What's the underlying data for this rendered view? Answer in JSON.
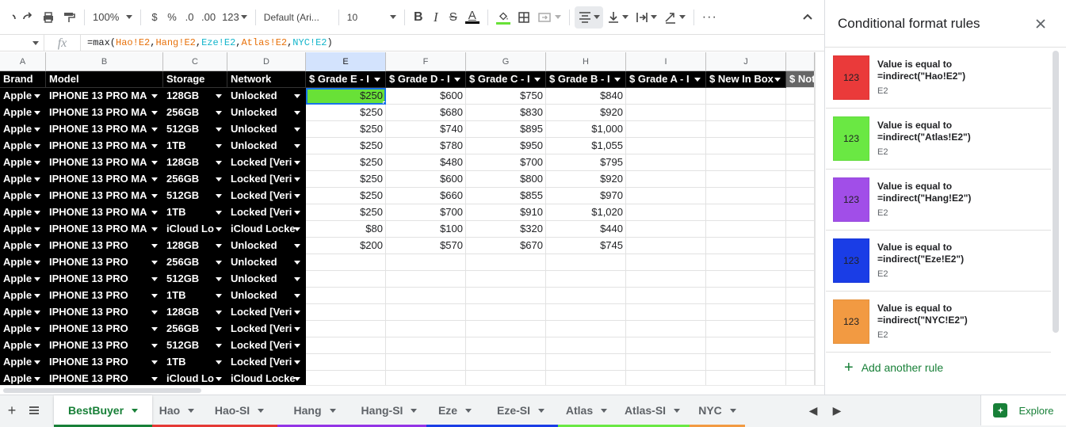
{
  "toolbar": {
    "zoom": "100%",
    "currency": "$",
    "percent": "%",
    "dec_decrease": ".0",
    "dec_increase": ".00",
    "more_formats": "123",
    "font": "Default (Ari...",
    "font_size": "10",
    "bold": "B",
    "italic": "I",
    "strike": "S",
    "text_color": "A",
    "more": "···"
  },
  "formula_bar": {
    "fx": "fx",
    "formula_prefix": "=max(",
    "refs": [
      "Hao!E2",
      "Hang!E2",
      "Eze!E2",
      "Atlas!E2",
      "NYC!E2"
    ],
    "comma": ",",
    "formula_suffix": ")"
  },
  "grid": {
    "columns": [
      "A",
      "B",
      "C",
      "D",
      "E",
      "F",
      "G",
      "H",
      "I",
      "J"
    ],
    "selected_column": "E",
    "headers": [
      "Brand",
      "Model",
      "Storage",
      "Network",
      "$ Grade E - I",
      "$ Grade D - I",
      "$ Grade C - I",
      "$ Grade B - I",
      "$ Grade A - I",
      "$ New In Box",
      "$ Not"
    ],
    "rows": [
      [
        "Apple",
        "IPHONE 13 PRO MA",
        "128GB",
        "Unlocked",
        "$250",
        "$600",
        "$750",
        "$840"
      ],
      [
        "Apple",
        "IPHONE 13 PRO MA",
        "256GB",
        "Unlocked",
        "$250",
        "$680",
        "$830",
        "$920"
      ],
      [
        "Apple",
        "IPHONE 13 PRO MA",
        "512GB",
        "Unlocked",
        "$250",
        "$740",
        "$895",
        "$1,000"
      ],
      [
        "Apple",
        "IPHONE 13 PRO MA",
        "1TB",
        "Unlocked",
        "$250",
        "$780",
        "$950",
        "$1,055"
      ],
      [
        "Apple",
        "IPHONE 13 PRO MA",
        "128GB",
        "Locked [Veri",
        "$250",
        "$480",
        "$700",
        "$795"
      ],
      [
        "Apple",
        "IPHONE 13 PRO MA",
        "256GB",
        "Locked [Veri",
        "$250",
        "$600",
        "$800",
        "$920"
      ],
      [
        "Apple",
        "IPHONE 13 PRO MA",
        "512GB",
        "Locked [Veri",
        "$250",
        "$660",
        "$855",
        "$970"
      ],
      [
        "Apple",
        "IPHONE 13 PRO MA",
        "1TB",
        "Locked [Veri",
        "$250",
        "$700",
        "$910",
        "$1,020"
      ],
      [
        "Apple",
        "IPHONE 13 PRO MA",
        "iCloud Lo",
        "iCloud Locke",
        "$80",
        "$100",
        "$320",
        "$440"
      ],
      [
        "Apple",
        "IPHONE 13 PRO",
        "128GB",
        "Unlocked",
        "$200",
        "$570",
        "$670",
        "$745"
      ],
      [
        "Apple",
        "IPHONE 13 PRO",
        "256GB",
        "Unlocked",
        "",
        "",
        "",
        ""
      ],
      [
        "Apple",
        "IPHONE 13 PRO",
        "512GB",
        "Unlocked",
        "",
        "",
        "",
        ""
      ],
      [
        "Apple",
        "IPHONE 13 PRO",
        "1TB",
        "Unlocked",
        "",
        "",
        "",
        ""
      ],
      [
        "Apple",
        "IPHONE 13 PRO",
        "128GB",
        "Locked [Veri",
        "",
        "",
        "",
        ""
      ],
      [
        "Apple",
        "IPHONE 13 PRO",
        "256GB",
        "Locked [Veri",
        "",
        "",
        "",
        ""
      ],
      [
        "Apple",
        "IPHONE 13 PRO",
        "512GB",
        "Locked [Veri",
        "",
        "",
        "",
        ""
      ],
      [
        "Apple",
        "IPHONE 13 PRO",
        "1TB",
        "Locked [Veri",
        "",
        "",
        "",
        ""
      ],
      [
        "Apple",
        "IPHONE 13 PRO",
        "iCloud Lo",
        "iCloud Locke",
        "",
        "",
        "",
        ""
      ]
    ],
    "highlight_color": "#68e137",
    "selection_color": "#1a73e8"
  },
  "sheet_tabs": [
    {
      "label": "BestBuyer",
      "color": "#188038",
      "active": true
    },
    {
      "label": "Hao",
      "color": "#e53935"
    },
    {
      "label": "Hao-SI",
      "color": "#e53935"
    },
    {
      "label": "Hang",
      "color": "#9334e6"
    },
    {
      "label": "Hang-SI",
      "color": "#9334e6"
    },
    {
      "label": "Eze",
      "color": "#1a3de6"
    },
    {
      "label": "Eze-SI",
      "color": "#1a3de6"
    },
    {
      "label": "Atlas",
      "color": "#6ae843"
    },
    {
      "label": "Atlas-SI",
      "color": "#6ae843"
    },
    {
      "label": "NYC",
      "color": "#f29a42"
    }
  ],
  "explore_label": "Explore",
  "panel": {
    "title": "Conditional format rules",
    "rules": [
      {
        "swatch": "123",
        "color": "#ea3a3a",
        "title": "Value is equal to",
        "formula": "=indirect(\"Hao!E2\")",
        "range": "E2"
      },
      {
        "swatch": "123",
        "color": "#6ae843",
        "title": "Value is equal to",
        "formula": "=indirect(\"Atlas!E2\")",
        "range": "E2"
      },
      {
        "swatch": "123",
        "color": "#a14ee8",
        "title": "Value is equal to",
        "formula": "=indirect(\"Hang!E2\")",
        "range": "E2"
      },
      {
        "swatch": "123",
        "color": "#1a3de6",
        "title": "Value is equal to",
        "formula": "=indirect(\"Eze!E2\")",
        "range": "E2"
      },
      {
        "swatch": "123",
        "color": "#f29a42",
        "title": "Value is equal to",
        "formula": "=indirect(\"NYC!E2\")",
        "range": "E2"
      }
    ],
    "add_rule": "Add another rule"
  }
}
